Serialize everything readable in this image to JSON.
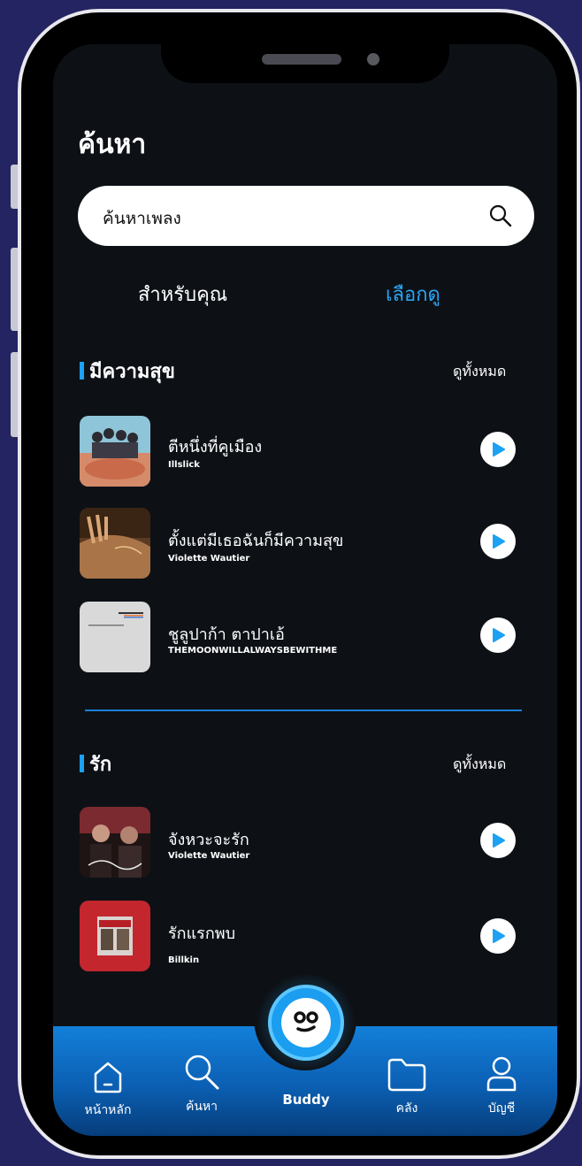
{
  "page": {
    "title": "ค้นหา"
  },
  "search": {
    "placeholder": "ค้นหาเพลง"
  },
  "tabs": [
    {
      "label": "สำหรับคุณ",
      "active": false
    },
    {
      "label": "เลือกดู",
      "active": true
    }
  ],
  "sections": [
    {
      "title": "มีความสุข",
      "see_all": "ดูทั้งหมด",
      "songs": [
        {
          "title": "ตีหนึ่งที่คูเมือง",
          "artist": "Illslick"
        },
        {
          "title": "ตั้งแต่มีเธอฉันก็มีความสุข",
          "artist": "Violette Wautier"
        },
        {
          "title": "ชูลูปาก้า ตาปาเอ้",
          "artist": "THEMOONWILLALWAYSBEWITHME"
        }
      ]
    },
    {
      "title": "รัก",
      "see_all": "ดูทั้งหมด",
      "songs": [
        {
          "title": "จังหวะจะรัก",
          "artist": "Violette Wautier"
        },
        {
          "title": "รักแรกพบ",
          "artist": "Billkin"
        }
      ]
    }
  ],
  "nav": {
    "home": "หน้าหลัก",
    "search": "ค้นหา",
    "buddy": "Buddy",
    "library": "คลัง",
    "account": "บัญชี"
  },
  "colors": {
    "accent": "#1da1f2",
    "background": "#0d1116",
    "outer": "#242462"
  }
}
